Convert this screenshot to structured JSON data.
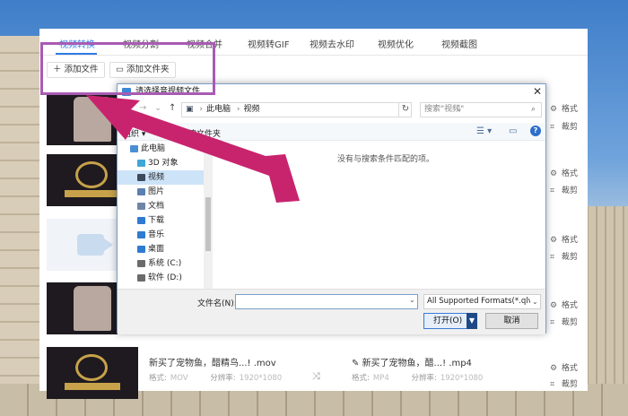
{
  "app": {
    "tabs": [
      "视频转换",
      "视频分割",
      "视频合并",
      "视频转GIF",
      "视频去水印",
      "视频优化",
      "视频截图"
    ],
    "active_tab": 0,
    "toolbar": {
      "add_file": "添加文件",
      "add_folder": "添加文件夹"
    },
    "row_actions": {
      "format": "格式",
      "crop": "裁剪"
    },
    "files": [
      {
        "name": "新买了宠物鱼，醋精鸟...! .mov",
        "format_label": "格式:",
        "format": "MOV",
        "resolution_label": "分辨率:",
        "resolution": "1920*1080"
      },
      {
        "name": "新买了宠物鱼，醋...! .mp4",
        "format_label": "格式:",
        "format": "MP4",
        "resolution_label": "分辨率:",
        "resolution": "1920*1080"
      }
    ]
  },
  "dialog": {
    "title": "请选择音视频文件",
    "address": {
      "root": "此电脑",
      "folder": "视频"
    },
    "search_placeholder": "搜索\"视频\"",
    "commands": {
      "organize": "组织 ▾",
      "new_folder": "新建文件夹"
    },
    "tree": [
      {
        "label": "此电脑",
        "icon": "computer-icon",
        "color": "#4a8fd6"
      },
      {
        "label": "3D 对象",
        "icon": "cube-icon",
        "color": "#3fa6d8"
      },
      {
        "label": "视频",
        "icon": "video-folder-icon",
        "color": "#3d4a5c"
      },
      {
        "label": "图片",
        "icon": "picture-folder-icon",
        "color": "#5a7fb0"
      },
      {
        "label": "文档",
        "icon": "document-folder-icon",
        "color": "#6d86a8"
      },
      {
        "label": "下载",
        "icon": "download-icon",
        "color": "#2f7bd2"
      },
      {
        "label": "音乐",
        "icon": "music-icon",
        "color": "#2f7bd2"
      },
      {
        "label": "桌面",
        "icon": "desktop-icon",
        "color": "#2f7bd2"
      },
      {
        "label": "系统 (C:)",
        "icon": "drive-icon",
        "color": "#6b6b6b"
      },
      {
        "label": "软件 (D:)",
        "icon": "drive-icon",
        "color": "#6b6b6b"
      }
    ],
    "selected_index": 2,
    "empty_message": "没有与搜索条件匹配的项。",
    "filename_label": "文件名(N):",
    "filename_value": "",
    "filetype": "All Supported Formats(*.qlv;",
    "open_button": "打开(O)",
    "cancel_button": "取消"
  },
  "colors": {
    "accent": "#2e7be6",
    "annotation_box": "#a95bb3",
    "annotation_arrow": "#c8246e"
  }
}
